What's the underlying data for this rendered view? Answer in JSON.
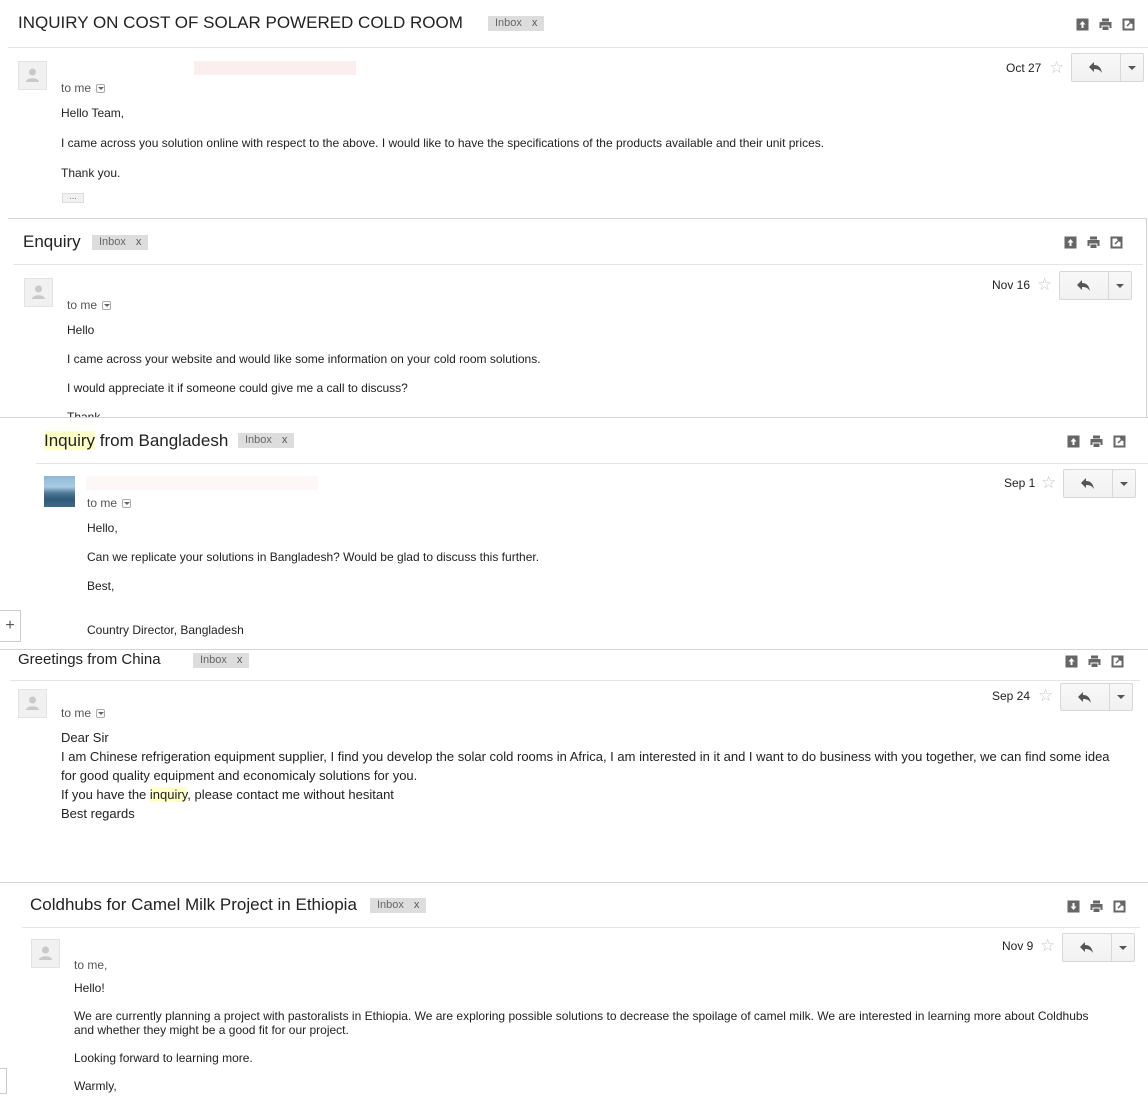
{
  "emails": [
    {
      "subject": "INQUIRY ON COST OF SOLAR POWERED COLD ROOM",
      "label": "Inbox",
      "label_close": "x",
      "to": "to me",
      "date": "Oct 27",
      "body": [
        "Hello Team,",
        "I came across you solution online with respect to the above. I would like to have the specifications of the products available and their unit prices.",
        "Thank you."
      ],
      "trimmed": "..."
    },
    {
      "subject": "Enquiry",
      "label": "Inbox",
      "label_close": "x",
      "to": "to me",
      "date": "Nov 16",
      "body": [
        "Hello",
        "I came across your website and would like some information on your cold room solutions.",
        "I would appreciate it if someone could give me a call to discuss?",
        "Thank"
      ]
    },
    {
      "subject_highlight": "Inquiry",
      "subject_rest": " from Bangladesh",
      "label": "Inbox",
      "label_close": "x",
      "to": "to me",
      "date": "Sep 1",
      "body": [
        "Hello,",
        "Can we replicate your solutions in Bangladesh? Would be glad to discuss this further.",
        "Best,",
        "Country Director, Bangladesh"
      ],
      "side_button": "+"
    },
    {
      "subject": "Greetings from China",
      "label": "Inbox",
      "label_close": "x",
      "to": "to me",
      "date": "Sep 24",
      "body": {
        "line1": "Dear Sir",
        "line2": "I am Chinese refrigeration equipment supplier, I find you develop the solar cold rooms in Africa, I am interested in it and I want to do business with you together, we can find some idea for good quality equipment and economicaly solutions for you.",
        "line3_pre": "If you have the ",
        "line3_hl": "inquiry",
        "line3_post": ", please contact me without hesitant",
        "line4": "Best regards"
      }
    },
    {
      "subject": "Coldhubs for Camel Milk Project in Ethiopia",
      "label": "Inbox",
      "label_close": "x",
      "to": "to me,",
      "date": "Nov 9",
      "body": [
        "Hello!",
        "We are currently planning a project with pastoralists in Ethiopia.  We are exploring possible solutions to decrease the spoilage of camel milk.  We are interested in learning more about Coldhubs and whether they might be a good fit for our project.",
        "Looking forward to learning more.",
        "Warmly,"
      ]
    }
  ],
  "icons": [
    "archive-icon",
    "print-icon",
    "new-window-icon",
    "reply-icon",
    "more-caret-icon",
    "star-icon",
    "avatar-icon",
    "move-to-inbox-icon"
  ]
}
